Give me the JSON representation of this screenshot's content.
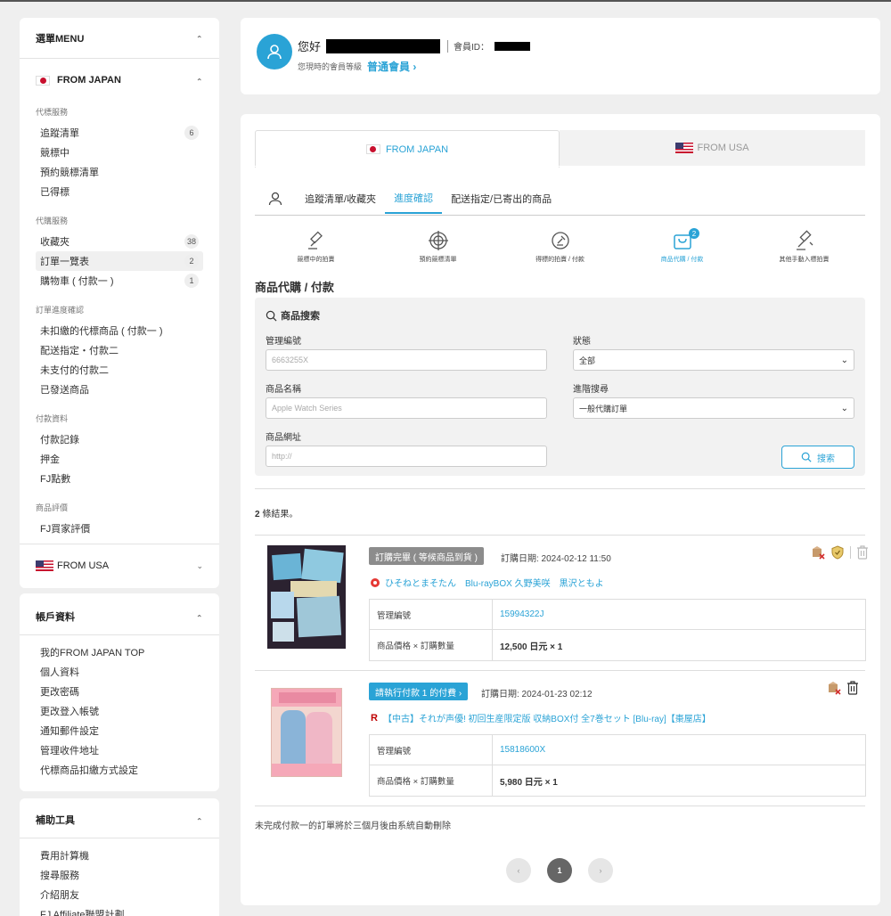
{
  "sidebar": {
    "menu_title": "選單MENU",
    "from_japan": "FROM JAPAN",
    "from_usa": "FROM USA",
    "groups": [
      {
        "label": "代標服務",
        "items": [
          {
            "label": "追蹤清單",
            "count": "6"
          },
          {
            "label": "競標中",
            "count": ""
          },
          {
            "label": "預約競標清單",
            "count": ""
          },
          {
            "label": "已得標",
            "count": ""
          }
        ]
      },
      {
        "label": "代購服務",
        "items": [
          {
            "label": "收藏夾",
            "count": "38"
          },
          {
            "label": "訂單一覽表",
            "count": "2"
          },
          {
            "label": "購物車 ( 付款一 )",
            "count": "1"
          }
        ]
      },
      {
        "label": "訂單進度確認",
        "items": [
          {
            "label": "未扣繳的代標商品 ( 付款一 )",
            "count": ""
          },
          {
            "label": "配送指定・付款二",
            "count": ""
          },
          {
            "label": "未支付的付款二",
            "count": ""
          },
          {
            "label": "已發送商品",
            "count": ""
          }
        ]
      },
      {
        "label": "付款資料",
        "items": [
          {
            "label": "付款記錄",
            "count": ""
          },
          {
            "label": "押金",
            "count": ""
          },
          {
            "label": "FJ點數",
            "count": ""
          }
        ]
      },
      {
        "label": "商品評價",
        "items": [
          {
            "label": "FJ買家評價",
            "count": ""
          }
        ]
      }
    ],
    "account": {
      "title": "帳戶資料",
      "items": [
        "我的FROM JAPAN TOP",
        "個人資料",
        "更改密碼",
        "更改登入帳號",
        "通知郵件設定",
        "管理收件地址",
        "代標商品扣繳方式設定"
      ]
    },
    "tools": {
      "title": "補助工具",
      "items": [
        "費用計算機",
        "搜尋服務",
        "介紹朋友",
        "FJ Affiliate聯盟計劃"
      ]
    }
  },
  "user": {
    "greeting": "您好",
    "member_id_label": "會員ID：",
    "level_label": "您現時的會員等級",
    "level": "普通會員 ›"
  },
  "tabs": {
    "japan": "FROM JAPAN",
    "usa": "FROM USA"
  },
  "subtabs": [
    "追蹤清單/收藏夾",
    "進度確認",
    "配送指定/已寄出的商品"
  ],
  "icon_nav": [
    {
      "label": "競標中的拍賣",
      "icon": "gavel-icon"
    },
    {
      "label": "預約競標清單",
      "icon": "target-icon"
    },
    {
      "label": "得標的拍賣 / 付款",
      "icon": "won-auction-icon"
    },
    {
      "label": "商品代購 / 付款",
      "icon": "shopping-bag-icon",
      "badge": "2"
    },
    {
      "label": "其他手動入標拍賣",
      "icon": "manual-bid-icon"
    }
  ],
  "section_title": "商品代購 / 付款",
  "search": {
    "title": "商品搜索",
    "mgmt_label": "管理編號",
    "mgmt_placeholder": "6663255X",
    "status_label": "狀態",
    "status_value": "全部",
    "name_label": "商品名稱",
    "name_placeholder": "Apple Watch Series",
    "advanced_label": "進階搜尋",
    "advanced_value": "一般代購訂單",
    "url_label": "商品網址",
    "url_placeholder": "http://",
    "button": "搜索"
  },
  "results_count": "2",
  "results_suffix": " 條結果。",
  "orders": [
    {
      "status": "訂購完畢 ( 等候商品到貨 )",
      "date": "訂購日期: 2024-02-12 11:50",
      "title": "ひそねとまそたん　Blu-rayBOX 久野美咲　黒沢ともよ",
      "mgmt_label": "管理編號",
      "mgmt_no": "15994322J",
      "price_label": "商品價格 × 訂購數量",
      "price": "12,500 日元 × 1"
    },
    {
      "status": "請執行付款 1 的付費 ›",
      "date": "訂購日期: 2024-01-23 02:12",
      "title": "【中古】それが声優! 初回生産限定版 収納BOX付 全7巻セット [Blu-ray]【棗屋店】",
      "mgmt_label": "管理編號",
      "mgmt_no": "15818600X",
      "price_label": "商品價格 × 訂購數量",
      "price": "5,980 日元 × 1"
    }
  ],
  "footer_note": "未完成付款一的訂單將於三個月後由系統自動刪除",
  "pagination": {
    "prev": "‹",
    "current": "1",
    "next": "›"
  },
  "colors": {
    "accent": "#2aa3d6",
    "pending": "#8c8c8c"
  }
}
